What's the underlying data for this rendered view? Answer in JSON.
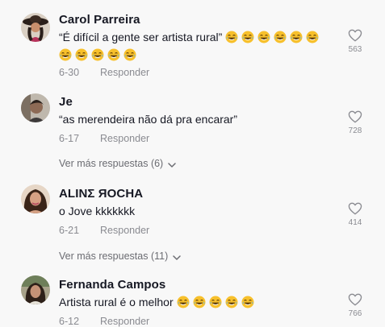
{
  "comments": [
    {
      "name": "Carol Parreira",
      "text": "“É difícil a gente ser artista rural”",
      "emoji_line1": 6,
      "emoji_line2": 5,
      "date": "6-30",
      "reply": "Responder",
      "likes": "563"
    },
    {
      "name": "Je",
      "text": "“as merendeira não dá pra encarar”",
      "date": "6-17",
      "reply": "Responder",
      "likes": "728",
      "more_replies": "Ver más respuestas (6)"
    },
    {
      "name": "ALINΣ ЯOCHA",
      "text": "o Jove kkkkkkk",
      "date": "6-21",
      "reply": "Responder",
      "likes": "414",
      "more_replies": "Ver más respuestas (11)"
    },
    {
      "name": "Fernanda Campos",
      "text": "Artista rural é o melhor",
      "emoji_count": 5,
      "date": "6-12",
      "reply": "Responder",
      "likes": "766"
    }
  ],
  "icons": {
    "like": "heart-outline-icon",
    "expand": "chevron-down-icon",
    "emoji": "laughing-tears-emoji-icon"
  },
  "colors": {
    "name": "#161823",
    "meta": "#8a8b91",
    "background": "#f8f8f8",
    "emoji": "#f7c02c"
  }
}
